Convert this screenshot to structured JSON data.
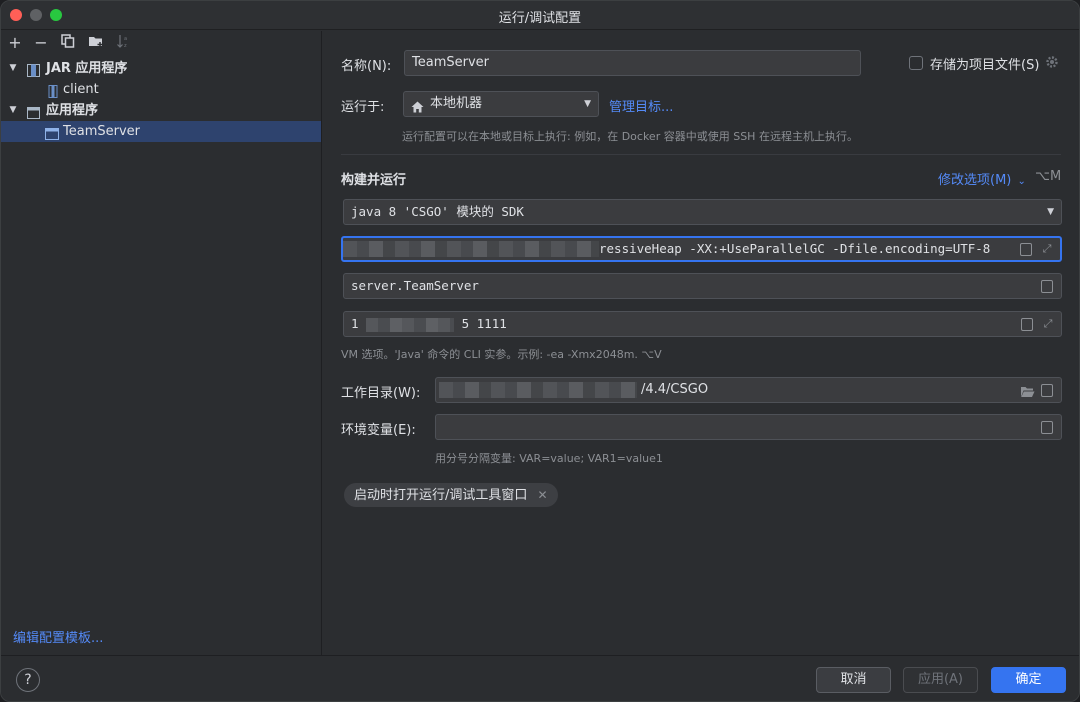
{
  "window": {
    "title": "运行/调试配置"
  },
  "toolbar": {
    "add": "+",
    "remove": "−"
  },
  "tree": {
    "group1": "JAR 应用程序",
    "group1_child": "client",
    "group2": "应用程序",
    "group2_child": "TeamServer"
  },
  "left_footer": {
    "edit_templates": "编辑配置模板..."
  },
  "form": {
    "name_label": "名称(N):",
    "name_value": "TeamServer",
    "store_label": "存储为项目文件(S)",
    "run_on_label": "运行于:",
    "run_on_value": "本地机器",
    "manage_targets": "管理目标...",
    "run_on_hint": "运行配置可以在本地或目标上执行: 例如，在 Docker 容器中或使用 SSH 在远程主机上执行。",
    "build_run_title": "构建并运行",
    "modify_options": "修改选项(M)",
    "modify_shortcut": "⌥M",
    "sdk_value": "java 8 'CSGO' 模块的 SDK",
    "vm_options_value": "ressiveHeap -XX:+UseParallelGC -Dfile.encoding=UTF-8",
    "main_class_value": "server.TeamServer",
    "program_args_prefix": "1",
    "program_args_suffix": "5 1111",
    "vm_hint": "VM 选项。'Java' 命令的 CLI 实参。示例: -ea -Xmx2048m. ⌥V",
    "workdir_label": "工作目录(W):",
    "workdir_value": "/4.4/CSGO",
    "env_label": "环境变量(E):",
    "env_value": "",
    "env_hint": "用分号分隔变量: VAR=value; VAR1=value1",
    "chip_label": "启动时打开运行/调试工具窗口"
  },
  "buttons": {
    "help": "?",
    "cancel": "取消",
    "apply": "应用(A)",
    "ok": "确定"
  },
  "colors": {
    "accent": "#3574f0",
    "link": "#548af7",
    "selection": "#2e436e"
  }
}
